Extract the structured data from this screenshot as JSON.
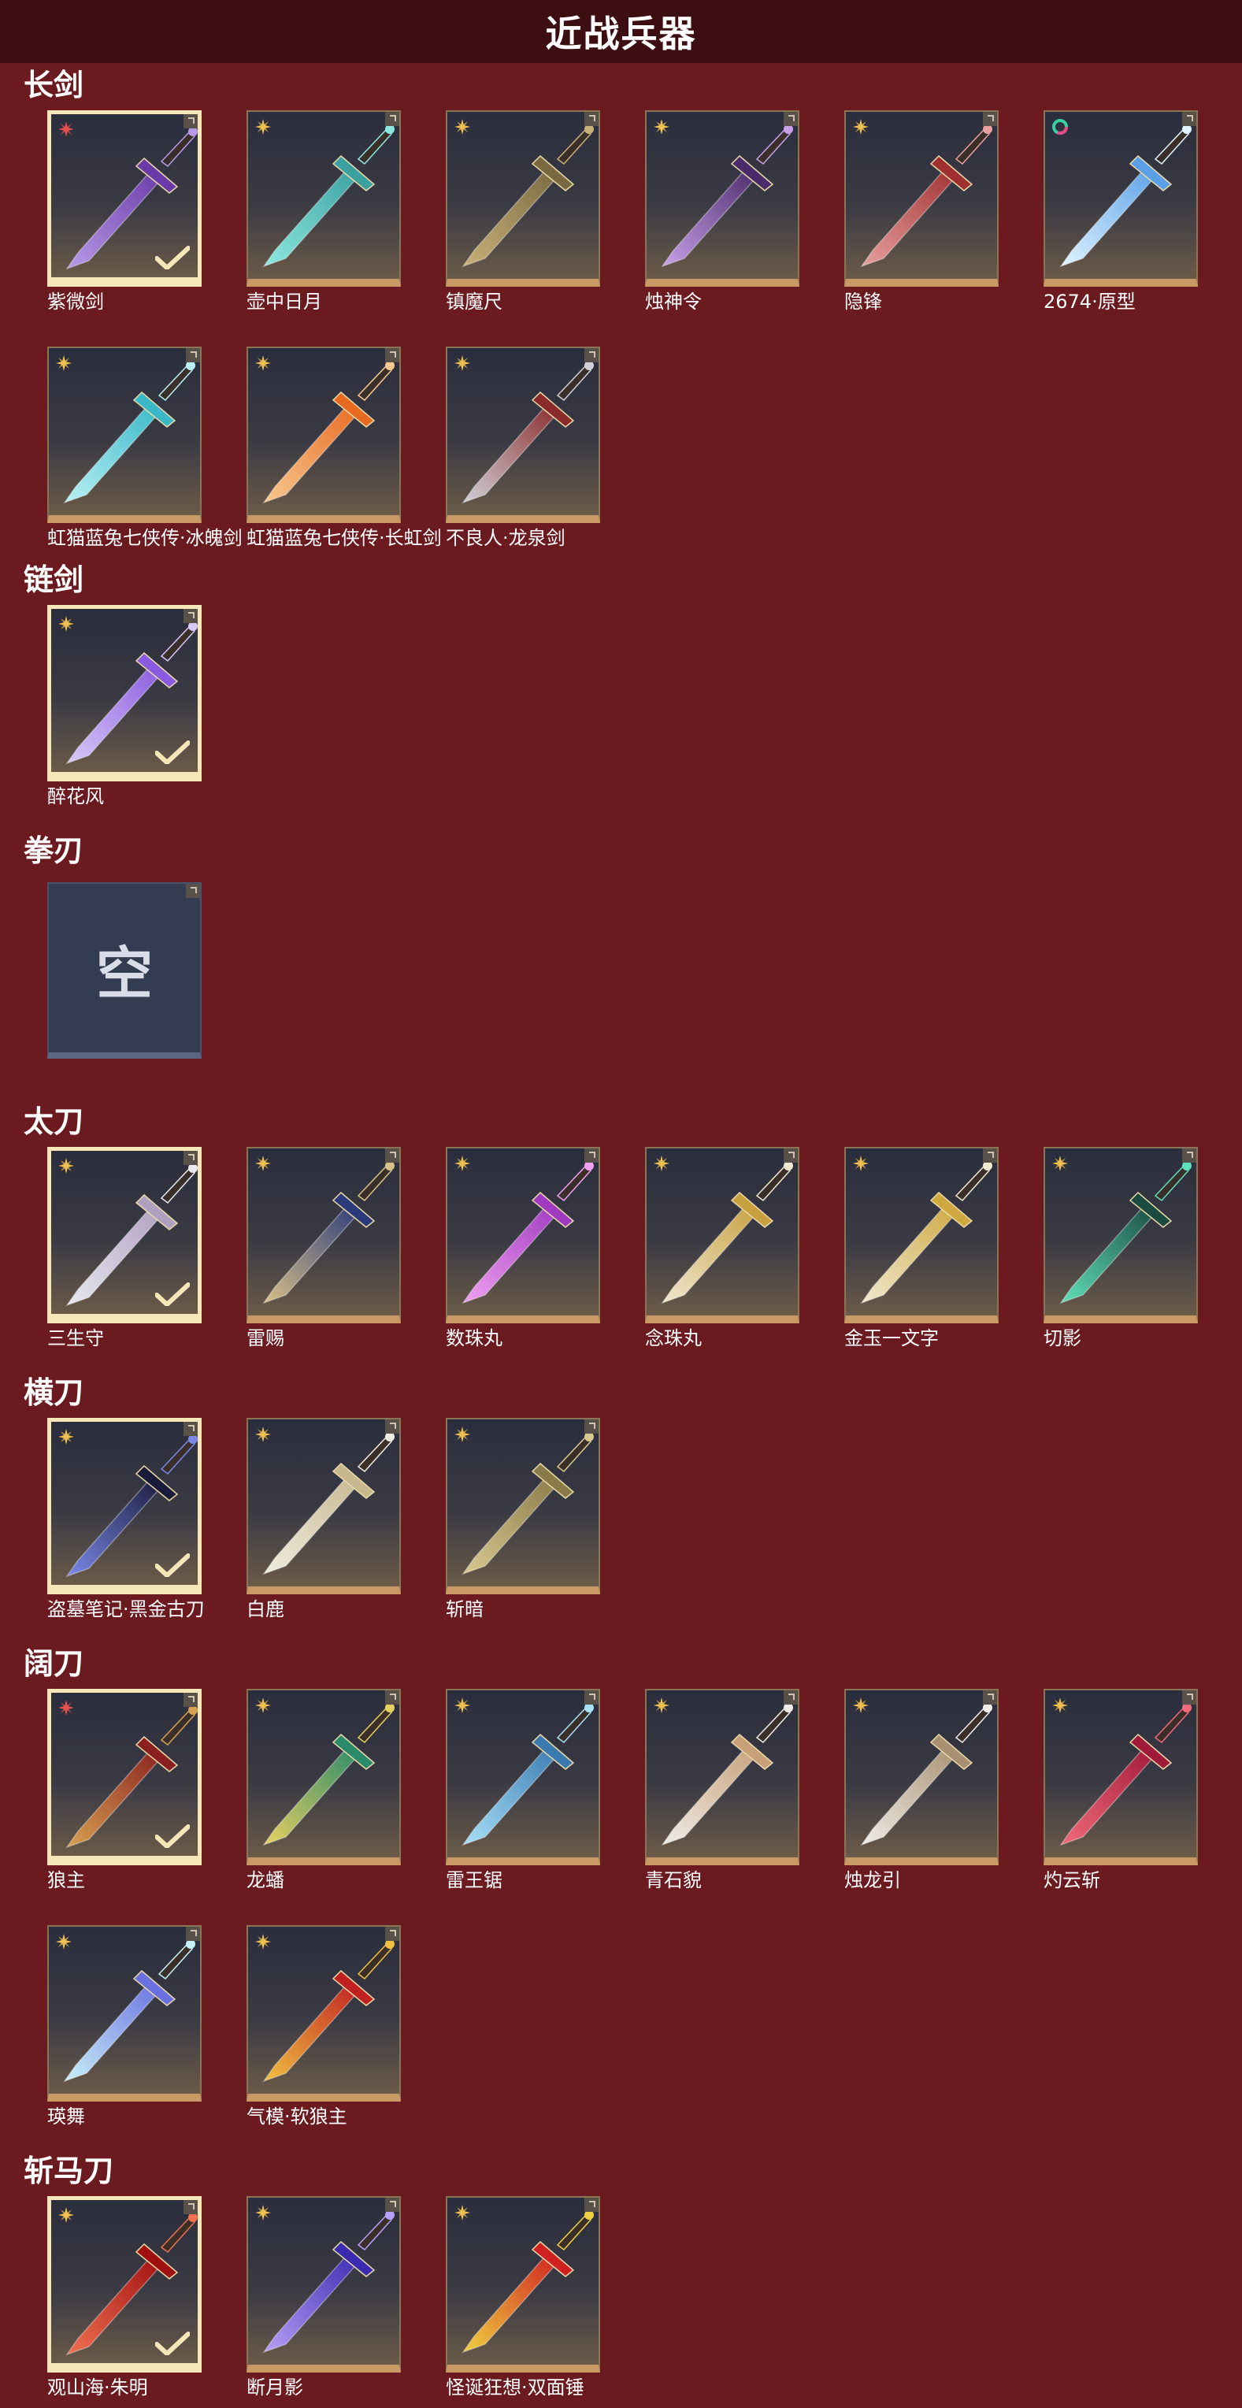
{
  "title": "近战兵器",
  "sections": [
    {
      "label": "长剑",
      "items": [
        {
          "name": "紫微剑",
          "rarity": "red",
          "equipped": true,
          "colors": [
            "#b89ae8",
            "#6a3aa8"
          ]
        },
        {
          "name": "壶中日月",
          "rarity": "gold",
          "equipped": false,
          "colors": [
            "#8ee8e0",
            "#3aa0a0"
          ]
        },
        {
          "name": "镇魔尺",
          "rarity": "gold",
          "equipped": false,
          "colors": [
            "#c8b078",
            "#7a6840"
          ]
        },
        {
          "name": "烛神令",
          "rarity": "gold",
          "equipped": false,
          "colors": [
            "#c8a0e8",
            "#4a2a6a"
          ]
        },
        {
          "name": "隐锋",
          "rarity": "gold",
          "equipped": false,
          "colors": [
            "#e8a0a0",
            "#a03030"
          ]
        },
        {
          "name": "2674·原型",
          "rarity": "rainbow",
          "equipped": false,
          "colors": [
            "#e0f4ff",
            "#5aa0e8"
          ]
        },
        {
          "name": "虹猫蓝兔七侠传·冰魄剑",
          "rarity": "gold",
          "equipped": false,
          "colors": [
            "#b8f0f4",
            "#3ab8c8"
          ]
        },
        {
          "name": "虹猫蓝兔七侠传·长虹剑",
          "rarity": "gold",
          "equipped": false,
          "colors": [
            "#f8c890",
            "#e86a20"
          ]
        },
        {
          "name": "不良人·龙泉剑",
          "rarity": "gold",
          "equipped": false,
          "colors": [
            "#d0d0d8",
            "#8a2a2a"
          ]
        }
      ]
    },
    {
      "label": "链剑",
      "items": [
        {
          "name": "醉花风",
          "rarity": "gold",
          "equipped": true,
          "colors": [
            "#d8c8f8",
            "#8a5ae0"
          ]
        }
      ]
    },
    {
      "label": "拳刃",
      "empty": true,
      "empty_text": "空"
    },
    {
      "label": "太刀",
      "items": [
        {
          "name": "三生守",
          "rarity": "gold",
          "equipped": true,
          "colors": [
            "#e8e8f0",
            "#b0a0c0"
          ]
        },
        {
          "name": "雷赐",
          "rarity": "gold",
          "equipped": false,
          "colors": [
            "#d8c088",
            "#2a3a7a"
          ]
        },
        {
          "name": "数珠丸",
          "rarity": "gold",
          "equipped": false,
          "colors": [
            "#f0a0f0",
            "#a03ac0"
          ]
        },
        {
          "name": "念珠丸",
          "rarity": "gold",
          "equipped": false,
          "colors": [
            "#f0e8d0",
            "#c8a040"
          ]
        },
        {
          "name": "金玉一文字",
          "rarity": "gold",
          "equipped": false,
          "colors": [
            "#f0e8d0",
            "#d0a840"
          ]
        },
        {
          "name": "切影",
          "rarity": "gold",
          "equipped": false,
          "colors": [
            "#60e0b8",
            "#1a4a40"
          ]
        }
      ]
    },
    {
      "label": "横刀",
      "items": [
        {
          "name": "盗墓笔记·黑金古刀",
          "rarity": "gold",
          "equipped": true,
          "colors": [
            "#7a88e8",
            "#1a1a3a"
          ]
        },
        {
          "name": "白鹿",
          "rarity": "gold",
          "equipped": false,
          "colors": [
            "#f0ece0",
            "#c8b890"
          ]
        },
        {
          "name": "斩暗",
          "rarity": "gold",
          "equipped": false,
          "colors": [
            "#d8c890",
            "#8a7a48"
          ]
        }
      ]
    },
    {
      "label": "阔刀",
      "items": [
        {
          "name": "狼主",
          "rarity": "red",
          "equipped": true,
          "colors": [
            "#d8a050",
            "#8a2020"
          ]
        },
        {
          "name": "龙蟠",
          "rarity": "gold",
          "equipped": false,
          "colors": [
            "#e8d060",
            "#2a8a6a"
          ]
        },
        {
          "name": "雷王锯",
          "rarity": "gold",
          "equipped": false,
          "colors": [
            "#a8e0f8",
            "#3a7ab0"
          ]
        },
        {
          "name": "青石貌",
          "rarity": "gold",
          "equipped": false,
          "colors": [
            "#f0ece8",
            "#c8a078"
          ]
        },
        {
          "name": "烛龙引",
          "rarity": "gold",
          "equipped": false,
          "colors": [
            "#f0ece8",
            "#a89070"
          ]
        },
        {
          "name": "灼云斩",
          "rarity": "gold",
          "equipped": false,
          "colors": [
            "#f06a7a",
            "#a01a3a"
          ]
        },
        {
          "name": "瑛舞",
          "rarity": "gold",
          "equipped": false,
          "colors": [
            "#c8f0f8",
            "#6a70e0"
          ]
        },
        {
          "name": "气模·软狼主",
          "rarity": "gold",
          "equipped": false,
          "colors": [
            "#f0c040",
            "#c02020"
          ]
        }
      ]
    },
    {
      "label": "斩马刀",
      "items": [
        {
          "name": "观山海·朱明",
          "rarity": "gold",
          "equipped": true,
          "colors": [
            "#f07050",
            "#a01010"
          ]
        },
        {
          "name": "断月影",
          "rarity": "gold",
          "equipped": false,
          "colors": [
            "#b8a0f8",
            "#3a2ab0"
          ]
        },
        {
          "name": "怪诞狂想·双面锤",
          "rarity": "gold",
          "equipped": false,
          "colors": [
            "#f0d040",
            "#d02020"
          ]
        }
      ]
    }
  ],
  "colors": {
    "background": "#6b1a1f",
    "title_bar": "#3c0e12",
    "card_border": "#c99a63",
    "equipped_border": "#f6e7b8",
    "rarity_gold": "#f0c050",
    "rarity_red": "#e85050",
    "empty_card": "#343c52"
  }
}
